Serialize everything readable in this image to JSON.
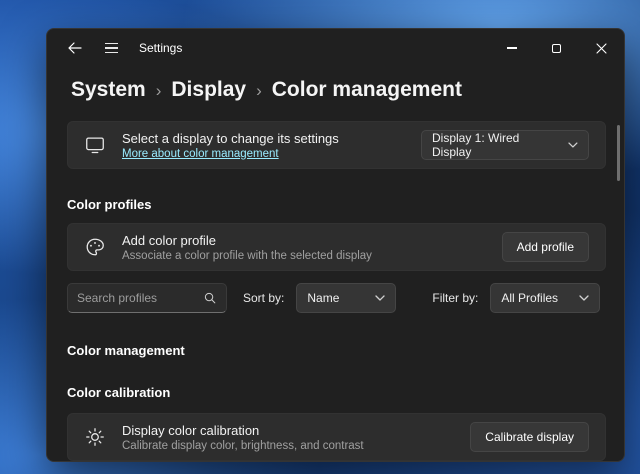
{
  "window": {
    "title": "Settings"
  },
  "breadcrumb": {
    "items": [
      "System",
      "Display",
      "Color management"
    ],
    "separator": "›"
  },
  "display_card": {
    "title": "Select a display to change its settings",
    "link": "More about color management",
    "dropdown_value": "Display 1: Wired Display"
  },
  "profiles": {
    "heading": "Color profiles",
    "add_title": "Add color profile",
    "add_description": "Associate a color profile with the selected display",
    "add_button": "Add profile",
    "search_placeholder": "Search profiles",
    "sort_label": "Sort by:",
    "sort_value": "Name",
    "filter_label": "Filter by:",
    "filter_value": "All Profiles"
  },
  "management": {
    "heading": "Color management"
  },
  "calibration": {
    "heading": "Color calibration",
    "title": "Display color calibration",
    "description": "Calibrate display color, brightness, and contrast",
    "button": "Calibrate display"
  },
  "icons": {
    "back-icon": "←",
    "hamburger-icon": "≡",
    "minimize-icon": "–",
    "maximize-icon": "□",
    "close-icon": "✕",
    "monitor-icon": "display",
    "palette-icon": "color-profile",
    "brightness-icon": "sun",
    "search-icon": "magnifier",
    "chevron-down-icon": "⌄",
    "chevron-right-icon": "›"
  },
  "colors": {
    "window_bg": "#202020",
    "card_bg": "#2d2d2d",
    "control_bg": "#373737",
    "link": "#99ebff",
    "text_secondary": "#a0a0a0"
  }
}
